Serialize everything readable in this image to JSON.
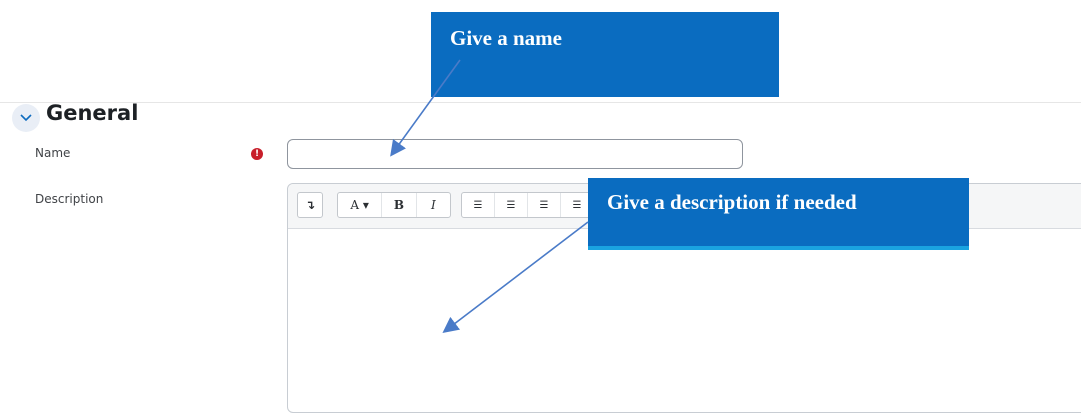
{
  "annotations": {
    "name_callout": "Give a name",
    "description_callout": "Give a description if needed"
  },
  "section": {
    "title": "General",
    "toggle_icon": "chevron-down-icon"
  },
  "form": {
    "name": {
      "label": "Name",
      "value": "",
      "required_icon": "exclamation-icon",
      "required_glyph": "!"
    },
    "description": {
      "label": "Description",
      "value": ""
    }
  },
  "editor": {
    "toolbar": {
      "collapse_glyph": "↴",
      "font_color_label": "A ▾",
      "bold_label": "B",
      "italic_label": "I",
      "unordered_list_glyph": "☰",
      "ordered_list_glyph": "☰",
      "outdent_glyph": "☰",
      "indent_glyph": "☰"
    }
  },
  "colors": {
    "callout_bg": "#0a6cc0",
    "arrow": "#4a7bc8",
    "required": "#c81e2a"
  }
}
